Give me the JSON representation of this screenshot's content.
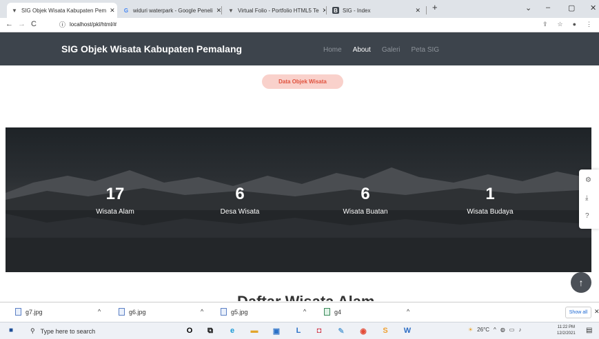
{
  "browser": {
    "tabs": [
      {
        "label": "SIG Objek Wisata Kabupaten Pem",
        "icon": "V",
        "active": true
      },
      {
        "label": "widuri waterpark - Google Peneli",
        "icon": "G",
        "active": false
      },
      {
        "label": "Virtual Folio - Portfolio HTML5 Te",
        "icon": "V",
        "active": false
      },
      {
        "label": "SIG - Index",
        "icon": "B",
        "active": false
      }
    ],
    "new_tab": "+",
    "url": "localhost/pkl/html/#",
    "window_controls": [
      "⌄",
      "–",
      "▢",
      "✕"
    ]
  },
  "site": {
    "brand": "SIG Objek Wisata Kabupaten Pemalang",
    "menu": [
      {
        "label": "Home",
        "active": false
      },
      {
        "label": "About",
        "active": true
      },
      {
        "label": "Galeri",
        "active": false
      },
      {
        "label": "Peta SIG",
        "active": false
      }
    ],
    "pill_label": "Data Objek Wisata",
    "stats": [
      {
        "value": "17",
        "label": "Wisata Alam"
      },
      {
        "value": "6",
        "label": "Desa Wisata"
      },
      {
        "value": "6",
        "label": "Wisata Buatan"
      },
      {
        "value": "1",
        "label": "Wisata Budaya"
      }
    ],
    "section_title": "Daftar Wisata Alam",
    "side_panel_icons": [
      "gear-icon",
      "download-icon",
      "help-icon"
    ],
    "fab_icon": "arrow-up-icon"
  },
  "downloads": {
    "items": [
      "g7.jpg",
      "g6.jpg",
      "g5.jpg",
      "g4"
    ],
    "show_all": "Show all"
  },
  "taskbar": {
    "search_placeholder": "Type here to search",
    "weather": "26°C",
    "time": "11:22 PM",
    "date": "12/2/2021"
  }
}
